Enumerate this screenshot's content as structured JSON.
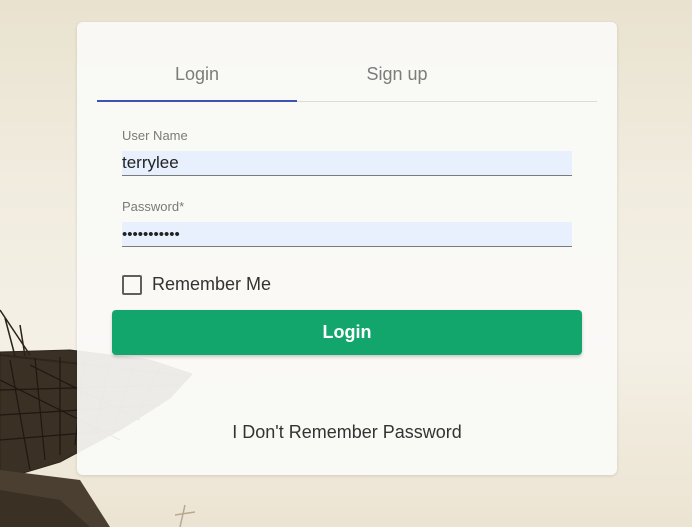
{
  "tabs": [
    {
      "label": "Login",
      "active": true
    },
    {
      "label": "Sign up",
      "active": false
    }
  ],
  "form": {
    "username": {
      "label": "User Name",
      "value": "terrylee"
    },
    "password": {
      "label": "Password*",
      "value": "•••••••••••"
    },
    "remember": {
      "label": "Remember Me",
      "checked": false
    },
    "submit_label": "Login",
    "forgot_label": "I Don't Remember Password"
  },
  "colors": {
    "accent_tab": "#3f51b5",
    "button": "#12a66d",
    "autofill_bg": "#e8f0fe"
  }
}
